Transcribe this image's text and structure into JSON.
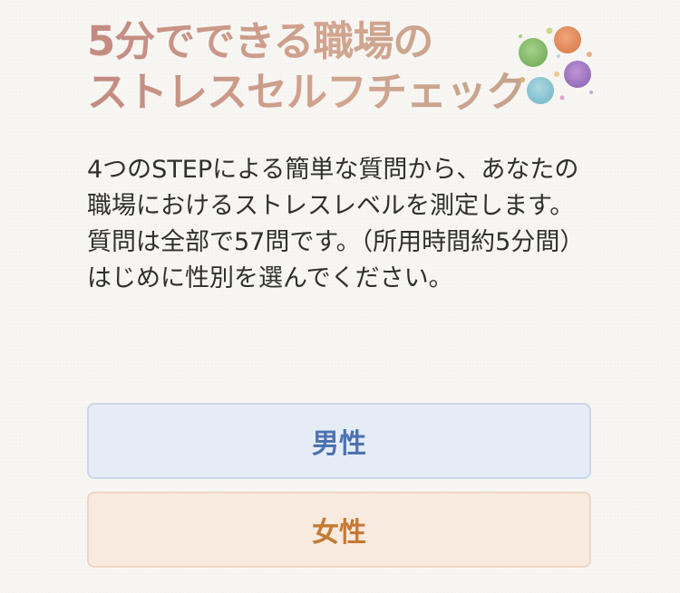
{
  "header": {
    "title_line1": "5分でできる職場の",
    "title_line2": "ストレスセルフチェック",
    "logo_icon": "watercolor-dots-icon",
    "logo_colors": [
      "#7ab55c",
      "#e2804f",
      "#9a6bc0",
      "#79bfcf"
    ]
  },
  "intro": {
    "paragraph1": "4つのSTEPによる簡単な質問から、あなたの職場におけるストレスレベルを測定します。",
    "paragraph2": "質問は全部で57問です。（所用時間約5分間）",
    "paragraph3": "はじめに性別を選んでください。"
  },
  "gender_choices": {
    "male_label": "男性",
    "female_label": "女性",
    "male_color": "#4d72b0",
    "female_color": "#c57a35"
  }
}
